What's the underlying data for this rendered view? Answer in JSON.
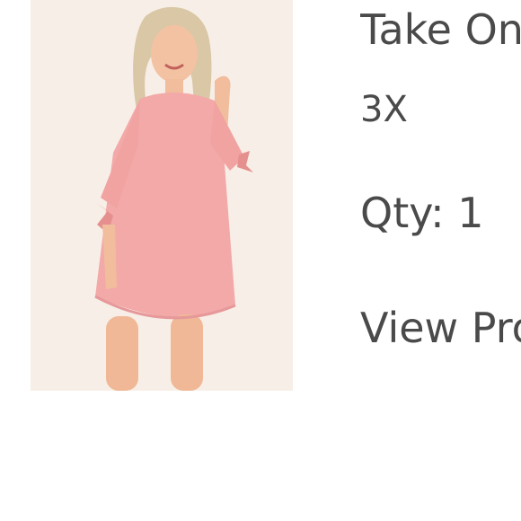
{
  "product": {
    "image_alt": "Pink shift dress with tie sleeves",
    "title": "Take On",
    "size": "3X",
    "quantity_text": "Qty: 1",
    "view_link": "View Product"
  },
  "colors": {
    "text": "#4a4a4a",
    "image_background": "#f7efe7",
    "dress": "#f2a9a8"
  }
}
